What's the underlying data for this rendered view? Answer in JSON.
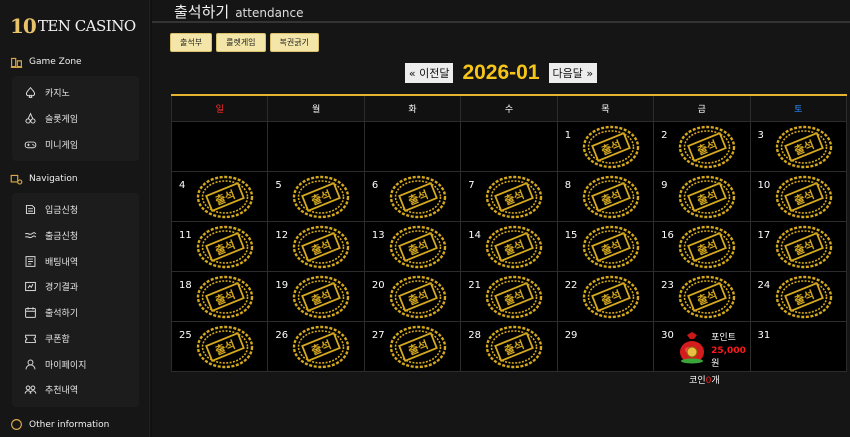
{
  "logo": {
    "brand": "TEN CASINO",
    "mark": "10",
    "name": "TEN CASINO"
  },
  "sidebar": {
    "game_zone": {
      "title": "Game Zone",
      "items": [
        {
          "label": "카지노",
          "icon": "spade-icon"
        },
        {
          "label": "슬롯게임",
          "icon": "cherries-icon"
        },
        {
          "label": "미니게임",
          "icon": "gamepad-icon"
        }
      ]
    },
    "navigation": {
      "title": "Navigation",
      "items": [
        {
          "label": "입금신청",
          "icon": "deposit-icon"
        },
        {
          "label": "출금신청",
          "icon": "withdraw-icon"
        },
        {
          "label": "배팅내역",
          "icon": "betting-history-icon"
        },
        {
          "label": "경기결과",
          "icon": "results-icon"
        },
        {
          "label": "출석하기",
          "icon": "calendar-icon"
        },
        {
          "label": "쿠폰함",
          "icon": "coupon-icon"
        },
        {
          "label": "마이페이지",
          "icon": "user-icon"
        },
        {
          "label": "추천내역",
          "icon": "referral-icon"
        }
      ]
    },
    "other": {
      "title": "Other information"
    }
  },
  "header": {
    "title_ko": "출석하기",
    "title_en": "attendance"
  },
  "tabs": [
    "출석부",
    "룰렛게임",
    "복권긁기"
  ],
  "month_nav": {
    "prev": "« 이전달",
    "month": "2026-01",
    "next": "다음달 »"
  },
  "calendar": {
    "weekdays": [
      "일",
      "월",
      "화",
      "수",
      "목",
      "금",
      "토"
    ],
    "colors": {
      "sunday": "#ff2a2a",
      "saturday": "#2a8cff",
      "accent": "#f5c518",
      "stamp": "#d4a81f"
    },
    "stamp_text": "출석",
    "first_weekday": 4,
    "days_in_month": 31,
    "attended_days": [
      1,
      2,
      3,
      4,
      5,
      6,
      7,
      8,
      9,
      10,
      11,
      12,
      13,
      14,
      15,
      16,
      17,
      18,
      19,
      20,
      21,
      22,
      23,
      24,
      25,
      26,
      27,
      28
    ],
    "reward": {
      "day": 30,
      "label": "포인트",
      "points": "25,000",
      "unit": "원",
      "coin_prefix": "코인",
      "coin_count": "0",
      "coin_suffix": "개"
    }
  }
}
